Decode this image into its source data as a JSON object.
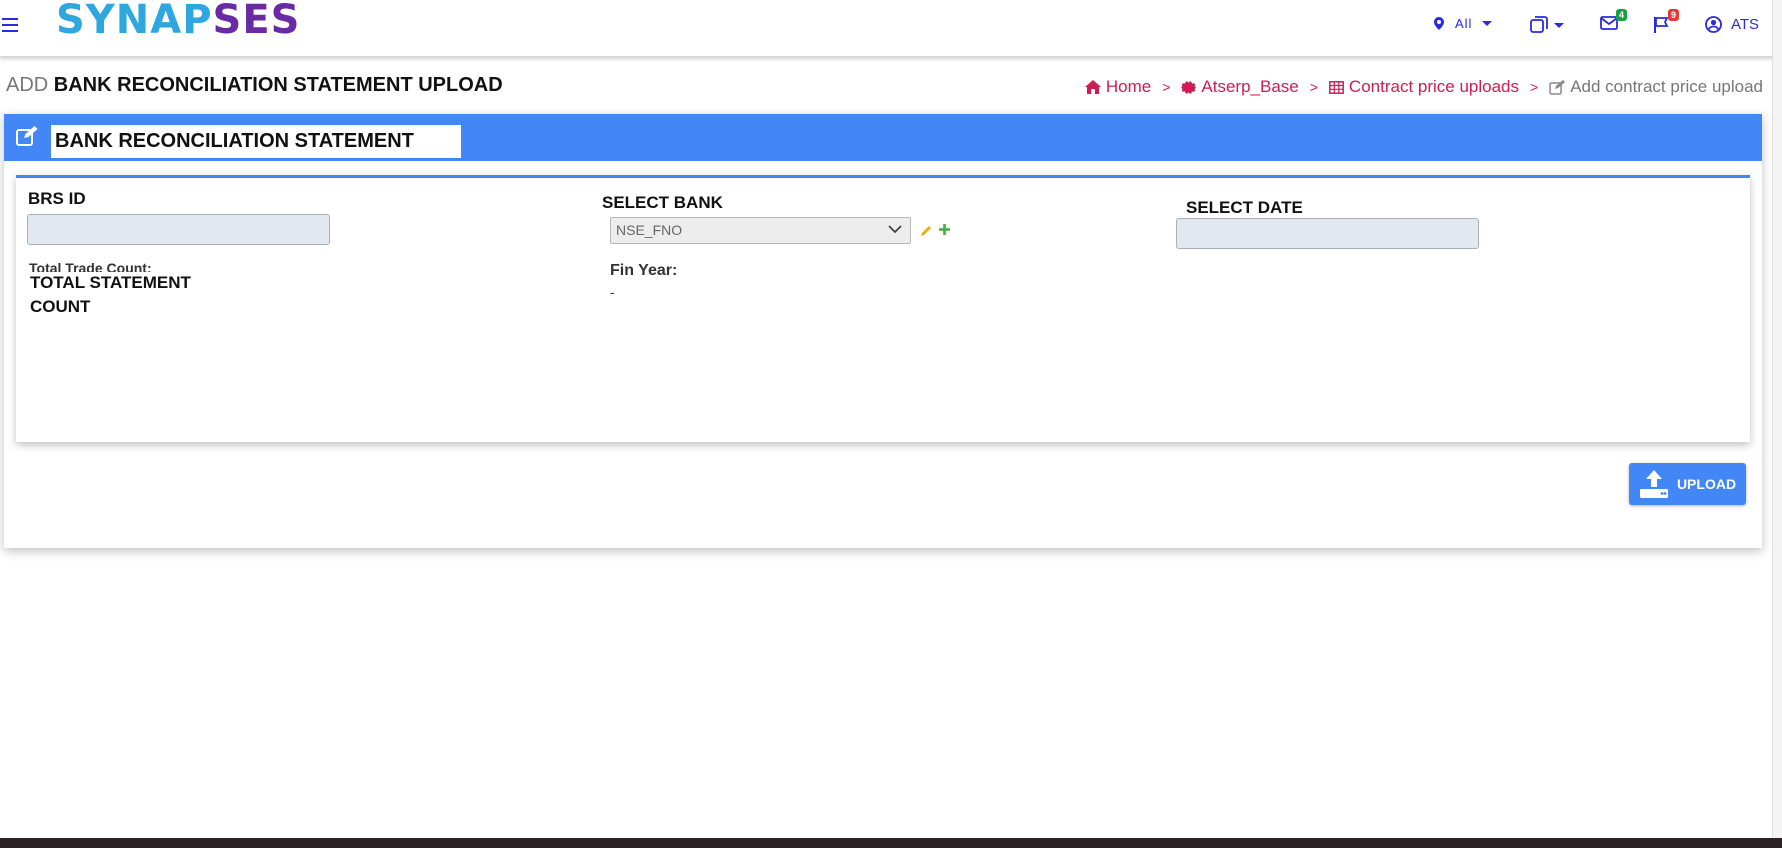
{
  "navbar": {
    "brand_part1": "SYNAP",
    "brand_part2": "SES",
    "location_label": "All",
    "mail_count": "4",
    "flag_count": "9",
    "user_label": "ATS"
  },
  "page": {
    "title_prefix": "ADD",
    "title_main": "BANK RECONCILIATION STATEMENT UPLOAD"
  },
  "breadcrumb": {
    "home": "Home",
    "base": "Atserp_Base",
    "list": "Contract price uploads",
    "current": "Add contract price upload",
    "separator": ">"
  },
  "card": {
    "title": "BANK RECONCILIATION STATEMENT"
  },
  "form": {
    "brs_id_label": "BRS ID",
    "select_bank_label": "SELECT BANK",
    "select_bank_value": "NSE_FNO",
    "select_date_label": "SELECT DATE",
    "total_trade_count_label": "Total Trade Count:",
    "total_statement_count_line1": "TOTAL STATEMENT",
    "total_statement_count_line2": "COUNT",
    "fin_year_label": "Fin Year:",
    "fin_year_value": "-"
  },
  "actions": {
    "upload_label": "UPLOAD"
  },
  "colors": {
    "primary": "#4287f5",
    "brand_blue": "#2ea6e0",
    "brand_purple": "#6a2aa3",
    "breadcrumb": "#d01c55"
  }
}
